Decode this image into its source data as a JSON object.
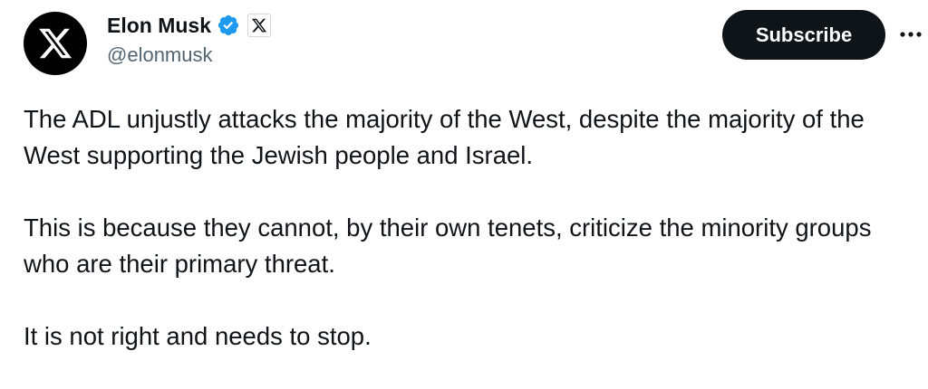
{
  "author": {
    "display_name": "Elon Musk",
    "handle": "@elonmusk",
    "verified": true,
    "verified_color": "#1d9bf0",
    "avatar_icon": "x-logo-icon",
    "affiliate_badge_icon": "x-badge-icon"
  },
  "actions": {
    "subscribe_label": "Subscribe",
    "more_icon": "more-horizontal-icon"
  },
  "tweet": {
    "paragraphs": [
      "The ADL unjustly attacks the majority of the West, despite the majority of the West supporting the Jewish people and Israel.",
      "This is because they cannot, by their own tenets, criticize the minority groups who are their primary threat.",
      "It is not right and needs to stop."
    ]
  },
  "colors": {
    "text_primary": "#0f1419",
    "text_secondary": "#536471",
    "button_bg": "#0f1419",
    "button_text": "#ffffff"
  }
}
